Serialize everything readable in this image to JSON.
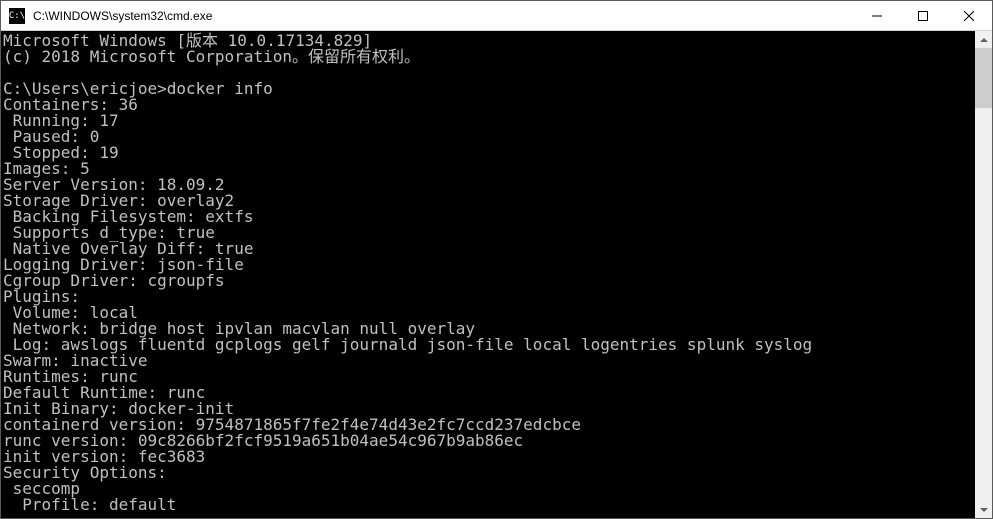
{
  "window": {
    "icon_label": "C:\\",
    "title": "C:\\WINDOWS\\system32\\cmd.exe"
  },
  "terminal": {
    "lines": [
      "Microsoft Windows [版本 10.0.17134.829]",
      "(c) 2018 Microsoft Corporation。保留所有权利。",
      "",
      "C:\\Users\\ericjoe>docker info",
      "Containers: 36",
      " Running: 17",
      " Paused: 0",
      " Stopped: 19",
      "Images: 5",
      "Server Version: 18.09.2",
      "Storage Driver: overlay2",
      " Backing Filesystem: extfs",
      " Supports d_type: true",
      " Native Overlay Diff: true",
      "Logging Driver: json-file",
      "Cgroup Driver: cgroupfs",
      "Plugins:",
      " Volume: local",
      " Network: bridge host ipvlan macvlan null overlay",
      " Log: awslogs fluentd gcplogs gelf journald json-file local logentries splunk syslog",
      "Swarm: inactive",
      "Runtimes: runc",
      "Default Runtime: runc",
      "Init Binary: docker-init",
      "containerd version: 9754871865f7fe2f4e74d43e2fc7ccd237edcbce",
      "runc version: 09c8266bf2fcf9519a651b04ae54c967b9ab86ec",
      "init version: fec3683",
      "Security Options:",
      " seccomp",
      "  Profile: default"
    ]
  }
}
